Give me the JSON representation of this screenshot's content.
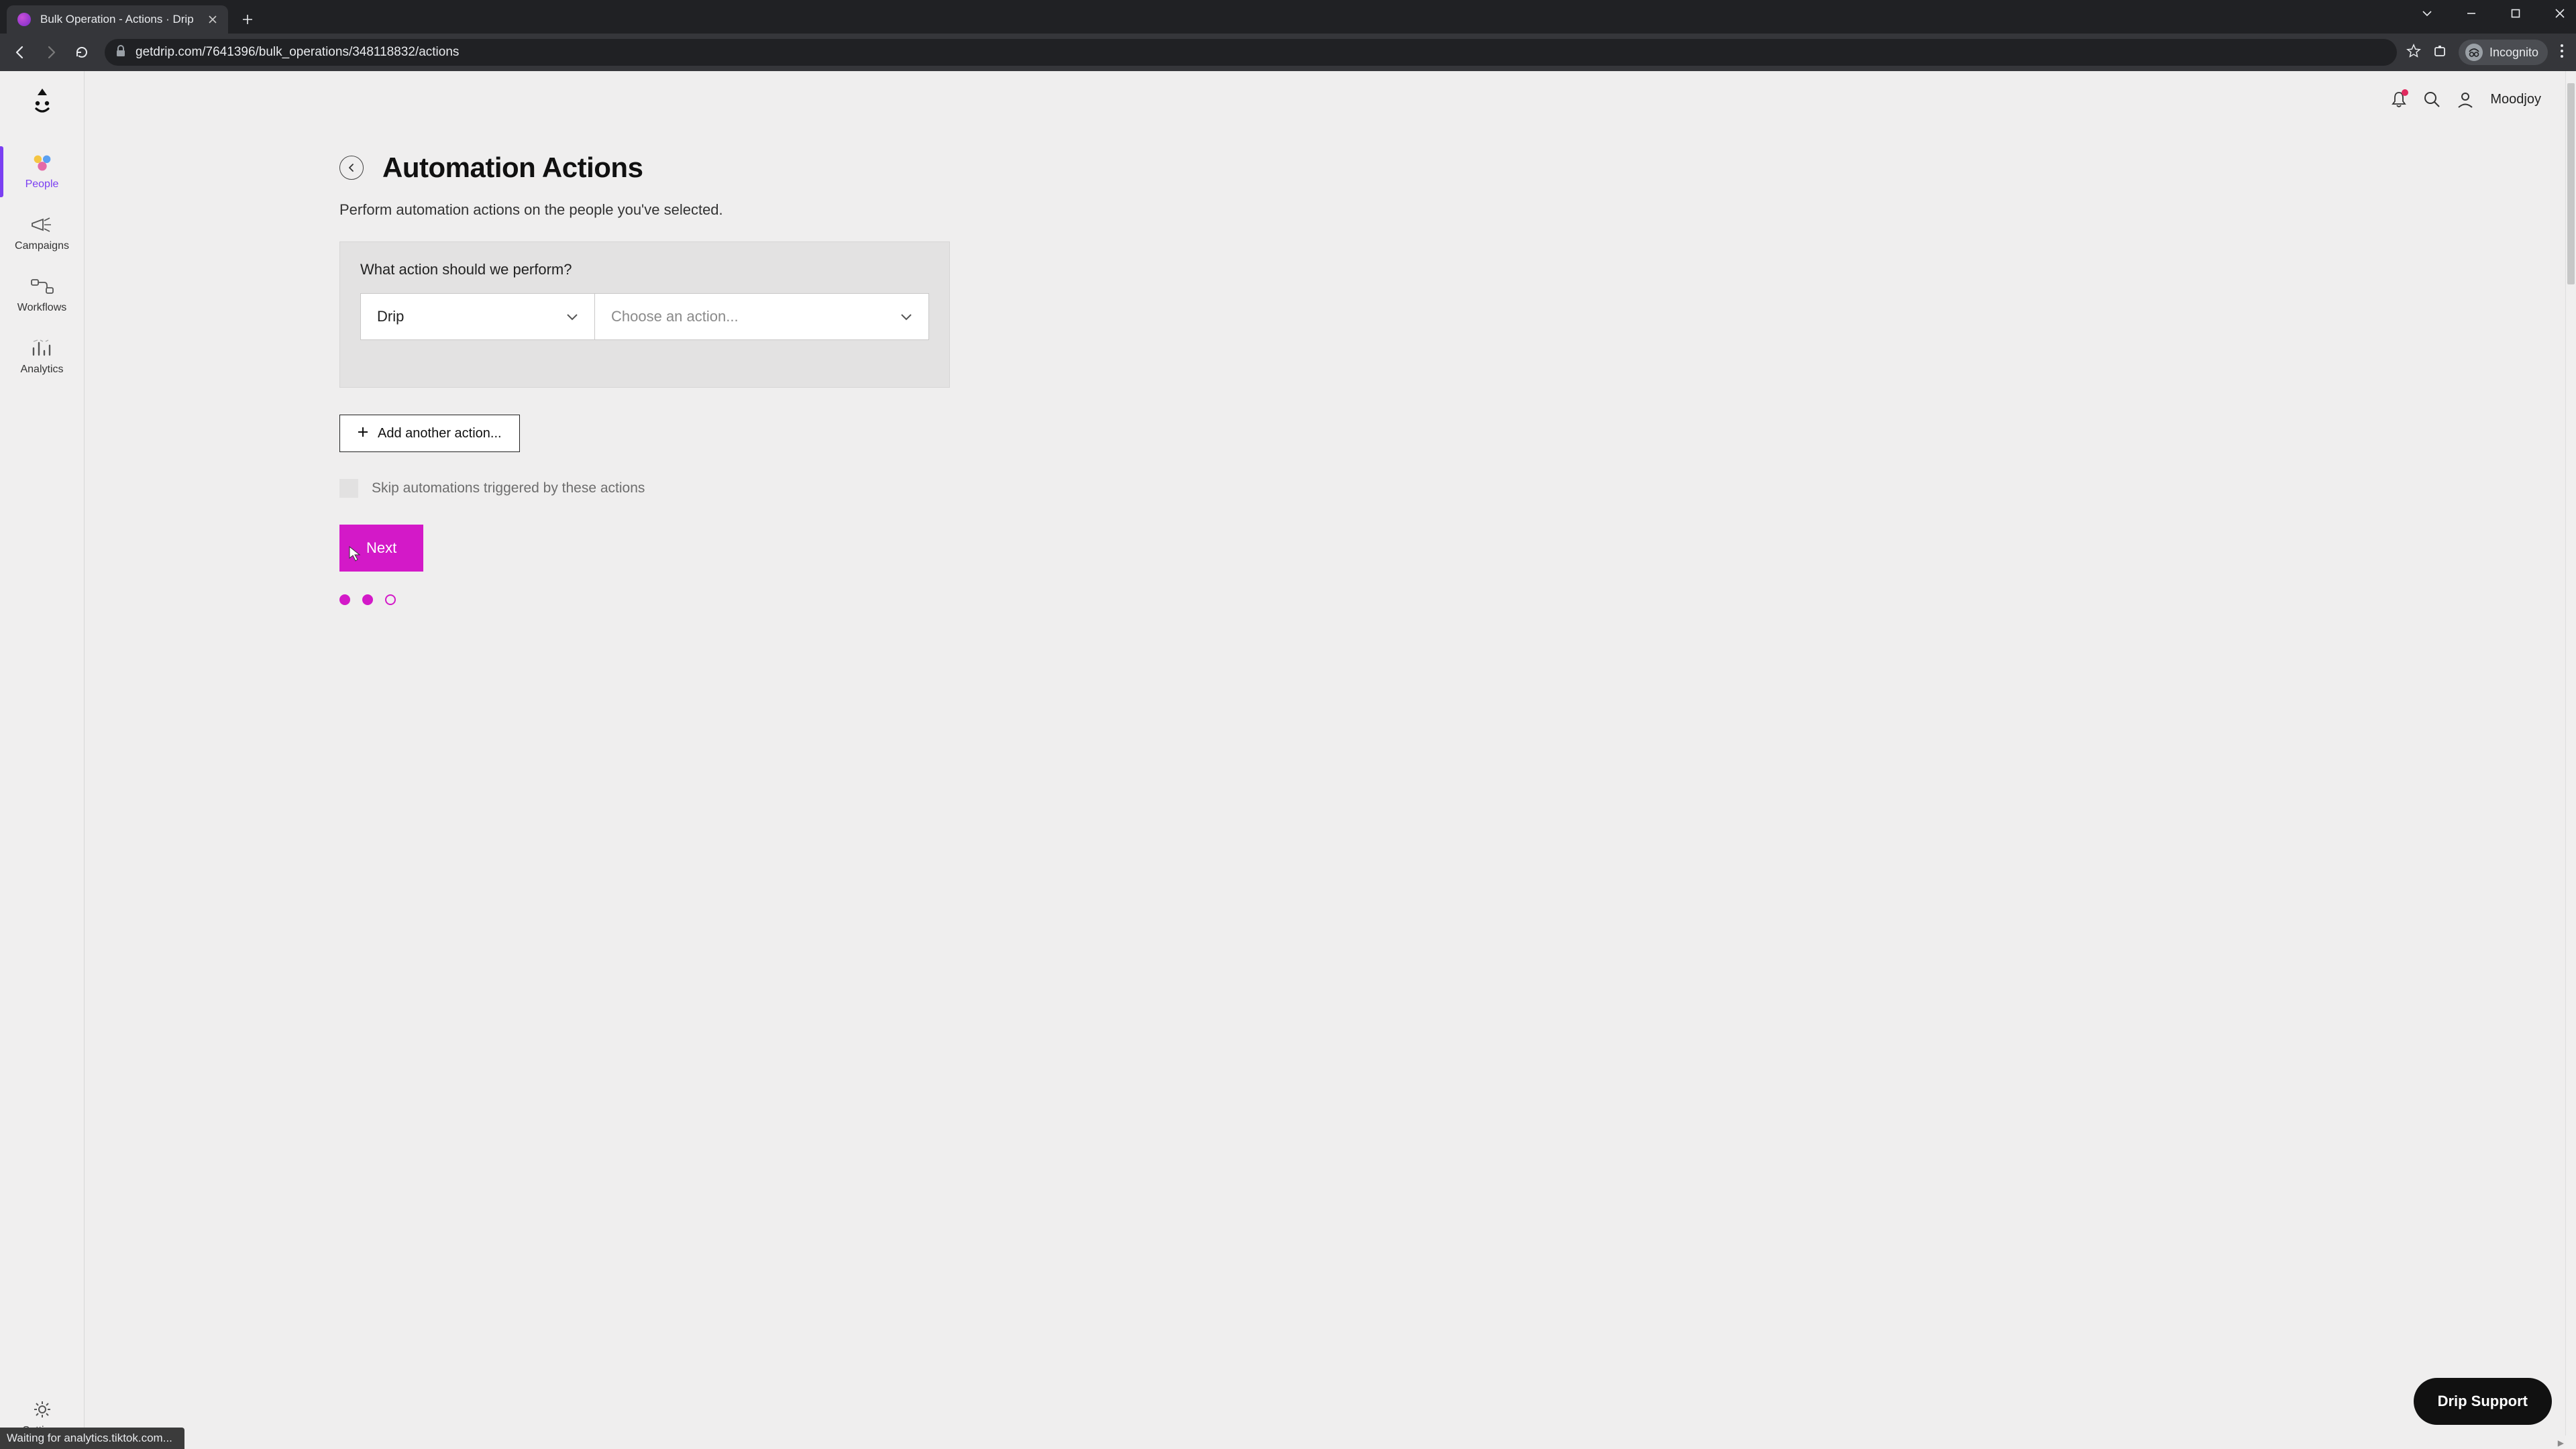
{
  "browser": {
    "tab_title": "Bulk Operation - Actions · Drip",
    "url": "getdrip.com/7641396/bulk_operations/348118832/actions",
    "incognito_label": "Incognito",
    "status_text": "Waiting for analytics.tiktok.com..."
  },
  "sidebar": {
    "items": [
      {
        "label": "People",
        "active": true
      },
      {
        "label": "Campaigns",
        "active": false
      },
      {
        "label": "Workflows",
        "active": false
      },
      {
        "label": "Analytics",
        "active": false
      }
    ],
    "settings_label": "Settings"
  },
  "topbar": {
    "username": "Moodjoy"
  },
  "page": {
    "title": "Automation Actions",
    "subtitle": "Perform automation actions on the people you've selected.",
    "card_question": "What action should we perform?",
    "provider_value": "Drip",
    "action_placeholder": "Choose an action...",
    "add_action_label": "Add another action...",
    "skip_label": "Skip automations triggered by these actions",
    "next_label": "Next",
    "step_current": 2,
    "step_total": 3
  },
  "support": {
    "label": "Drip Support"
  }
}
